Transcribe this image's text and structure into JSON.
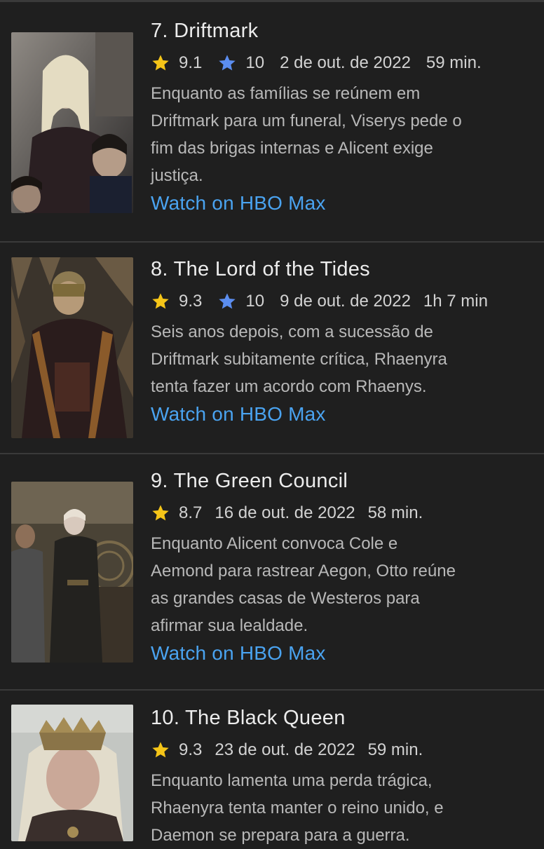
{
  "episodes": [
    {
      "title": "7. Driftmark",
      "rating": "9.1",
      "user_rating": "10",
      "date": "2 de out. de 2022",
      "duration": "59 min.",
      "description": "Enquanto as famílias se reúnem em\nDriftmark para um funeral, Viserys pede o\nfim das brigas internas e Alicent exige\njustiça.",
      "watch_label": "Watch on HBO Max"
    },
    {
      "title": "8. The Lord of the Tides",
      "rating": "9.3",
      "user_rating": "10",
      "date": "9 de out. de 2022",
      "duration": "1h 7 min",
      "description": "Seis anos depois, com a sucessão de\nDriftmark subitamente crítica, Rhaenyra\ntenta fazer um acordo com Rhaenys.",
      "watch_label": "Watch on HBO Max"
    },
    {
      "title": "9. The Green Council",
      "rating": "8.7",
      "date": "16 de out. de 2022",
      "duration": "58 min.",
      "description": "Enquanto Alicent convoca Cole e\nAemond para rastrear Aegon, Otto reúne\nas grandes casas de Westeros para\nafirmar sua lealdade.",
      "watch_label": "Watch on HBO Max"
    },
    {
      "title": "10. The Black Queen",
      "rating": "9.3",
      "date": "23 de out. de 2022",
      "duration": "59 min.",
      "description": "Enquanto lamenta uma perda trágica,\nRhaenyra tenta manter o reino unido, e\nDaemon se prepara para a guerra.",
      "watch_label": ""
    }
  ],
  "colors": {
    "background": "#1f1f1f",
    "divider": "#3a3a3a",
    "star_gold": "#f5c518",
    "star_blue": "#5b8def",
    "link": "#4aa3f0"
  },
  "icons": {
    "rating": "star-icon",
    "user_rating": "user-star-icon"
  }
}
